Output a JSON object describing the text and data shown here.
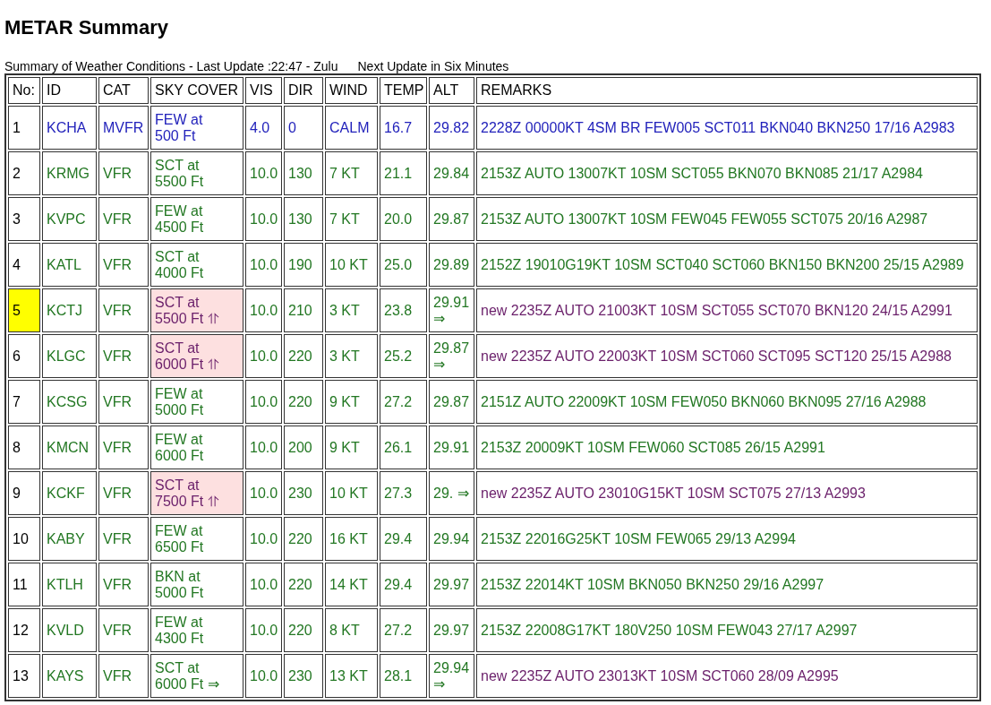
{
  "title": "METAR Summary",
  "subtitle": "Summary of Weather Conditions - Last Update :22:47 - Zulu",
  "next_update": "Next Update in Six Minutes",
  "table": {
    "columns": [
      "No:",
      "ID",
      "CAT",
      "SKY COVER",
      "VIS",
      "DIR",
      "WIND",
      "TEMP",
      "ALT",
      "REMARKS"
    ],
    "rows": [
      {
        "no": "1",
        "id": "KCHA",
        "cat": "MVFR",
        "sky": "FEW at 500 Ft",
        "sky_changed": false,
        "vis": "4.0",
        "dir": "0",
        "wind": "CALM",
        "temp": "16.7",
        "alt": "29.82",
        "remarks": "2228Z 00000KT 4SM BR FEW005 SCT011 BKN040 BKN250 17/16 A2983",
        "is_new": false,
        "highlighted": false,
        "color": "#2222bb"
      },
      {
        "no": "2",
        "id": "KRMG",
        "cat": "VFR",
        "sky": "SCT at 5500 Ft",
        "sky_changed": false,
        "vis": "10.0",
        "dir": "130",
        "wind": "7 KT",
        "temp": "21.1",
        "alt": "29.84",
        "remarks": "2153Z AUTO 13007KT 10SM SCT055 BKN070 BKN085 21/17 A2984",
        "is_new": false,
        "highlighted": false,
        "color": "#227722"
      },
      {
        "no": "3",
        "id": "KVPC",
        "cat": "VFR",
        "sky": "FEW at 4500 Ft",
        "sky_changed": false,
        "vis": "10.0",
        "dir": "130",
        "wind": "7 KT",
        "temp": "20.0",
        "alt": "29.87",
        "remarks": "2153Z AUTO 13007KT 10SM FEW045 FEW055 SCT075 20/16 A2987",
        "is_new": false,
        "highlighted": false,
        "color": "#227722"
      },
      {
        "no": "4",
        "id": "KATL",
        "cat": "VFR",
        "sky": "SCT at 4000 Ft",
        "sky_changed": false,
        "vis": "10.0",
        "dir": "190",
        "wind": "10 KT",
        "temp": "25.0",
        "alt": "29.89",
        "remarks": "2152Z 19010G19KT 10SM SCT040 SCT060 BKN150 BKN200 25/15 A2989",
        "is_new": false,
        "highlighted": false,
        "color": "#227722"
      },
      {
        "no": "5",
        "id": "KCTJ",
        "cat": "VFR",
        "sky": "SCT at 5500 Ft ⥣",
        "sky_changed": true,
        "vis": "10.0",
        "dir": "210",
        "wind": "3 KT",
        "temp": "23.8",
        "alt": "29.91 ⇒",
        "remarks": "new 2235Z AUTO 21003KT 10SM SCT055 SCT070 BKN120 24/15 A2991",
        "is_new": true,
        "highlighted": true,
        "color": "#227722"
      },
      {
        "no": "6",
        "id": "KLGC",
        "cat": "VFR",
        "sky": "SCT at 6000 Ft ⥣",
        "sky_changed": true,
        "vis": "10.0",
        "dir": "220",
        "wind": "3 KT",
        "temp": "25.2",
        "alt": "29.87 ⇒",
        "remarks": "new 2235Z AUTO 22003KT 10SM SCT060 SCT095 SCT120 25/15 A2988",
        "is_new": true,
        "highlighted": false,
        "color": "#227722"
      },
      {
        "no": "7",
        "id": "KCSG",
        "cat": "VFR",
        "sky": "FEW at 5000 Ft",
        "sky_changed": false,
        "vis": "10.0",
        "dir": "220",
        "wind": "9 KT",
        "temp": "27.2",
        "alt": "29.87",
        "remarks": "2151Z AUTO 22009KT 10SM FEW050 BKN060 BKN095 27/16 A2988",
        "is_new": false,
        "highlighted": false,
        "color": "#227722"
      },
      {
        "no": "8",
        "id": "KMCN",
        "cat": "VFR",
        "sky": "FEW at 6000 Ft",
        "sky_changed": false,
        "vis": "10.0",
        "dir": "200",
        "wind": "9 KT",
        "temp": "26.1",
        "alt": "29.91",
        "remarks": "2153Z 20009KT 10SM FEW060 SCT085 26/15 A2991",
        "is_new": false,
        "highlighted": false,
        "color": "#227722"
      },
      {
        "no": "9",
        "id": "KCKF",
        "cat": "VFR",
        "sky": "SCT at 7500 Ft ⥣",
        "sky_changed": true,
        "vis": "10.0",
        "dir": "230",
        "wind": "10 KT",
        "temp": "27.3",
        "alt": "29. ⇒",
        "remarks": "new 2235Z AUTO 23010G15KT 10SM SCT075 27/13 A2993",
        "is_new": true,
        "highlighted": false,
        "color": "#227722"
      },
      {
        "no": "10",
        "id": "KABY",
        "cat": "VFR",
        "sky": "FEW at 6500 Ft",
        "sky_changed": false,
        "vis": "10.0",
        "dir": "220",
        "wind": "16 KT",
        "temp": "29.4",
        "alt": "29.94",
        "remarks": "2153Z 22016G25KT 10SM FEW065 29/13 A2994",
        "is_new": false,
        "highlighted": false,
        "color": "#227722"
      },
      {
        "no": "11",
        "id": "KTLH",
        "cat": "VFR",
        "sky": "BKN at 5000 Ft",
        "sky_changed": false,
        "vis": "10.0",
        "dir": "220",
        "wind": "14 KT",
        "temp": "29.4",
        "alt": "29.97",
        "remarks": "2153Z 22014KT 10SM BKN050 BKN250 29/16 A2997",
        "is_new": false,
        "highlighted": false,
        "color": "#227722"
      },
      {
        "no": "12",
        "id": "KVLD",
        "cat": "VFR",
        "sky": "FEW at 4300 Ft",
        "sky_changed": false,
        "vis": "10.0",
        "dir": "220",
        "wind": "8 KT",
        "temp": "27.2",
        "alt": "29.97",
        "remarks": "2153Z 22008G17KT 180V250 10SM FEW043 27/17 A2997",
        "is_new": false,
        "highlighted": false,
        "color": "#227722"
      },
      {
        "no": "13",
        "id": "KAYS",
        "cat": "VFR",
        "sky": "SCT at 6000 Ft ⇒",
        "sky_changed": false,
        "vis": "10.0",
        "dir": "230",
        "wind": "13 KT",
        "temp": "28.1",
        "alt": "29.94 ⇒",
        "remarks": "new 2235Z AUTO 23013KT 10SM SCT060 28/09 A2995",
        "is_new": true,
        "highlighted": false,
        "color": "#227722"
      }
    ]
  }
}
